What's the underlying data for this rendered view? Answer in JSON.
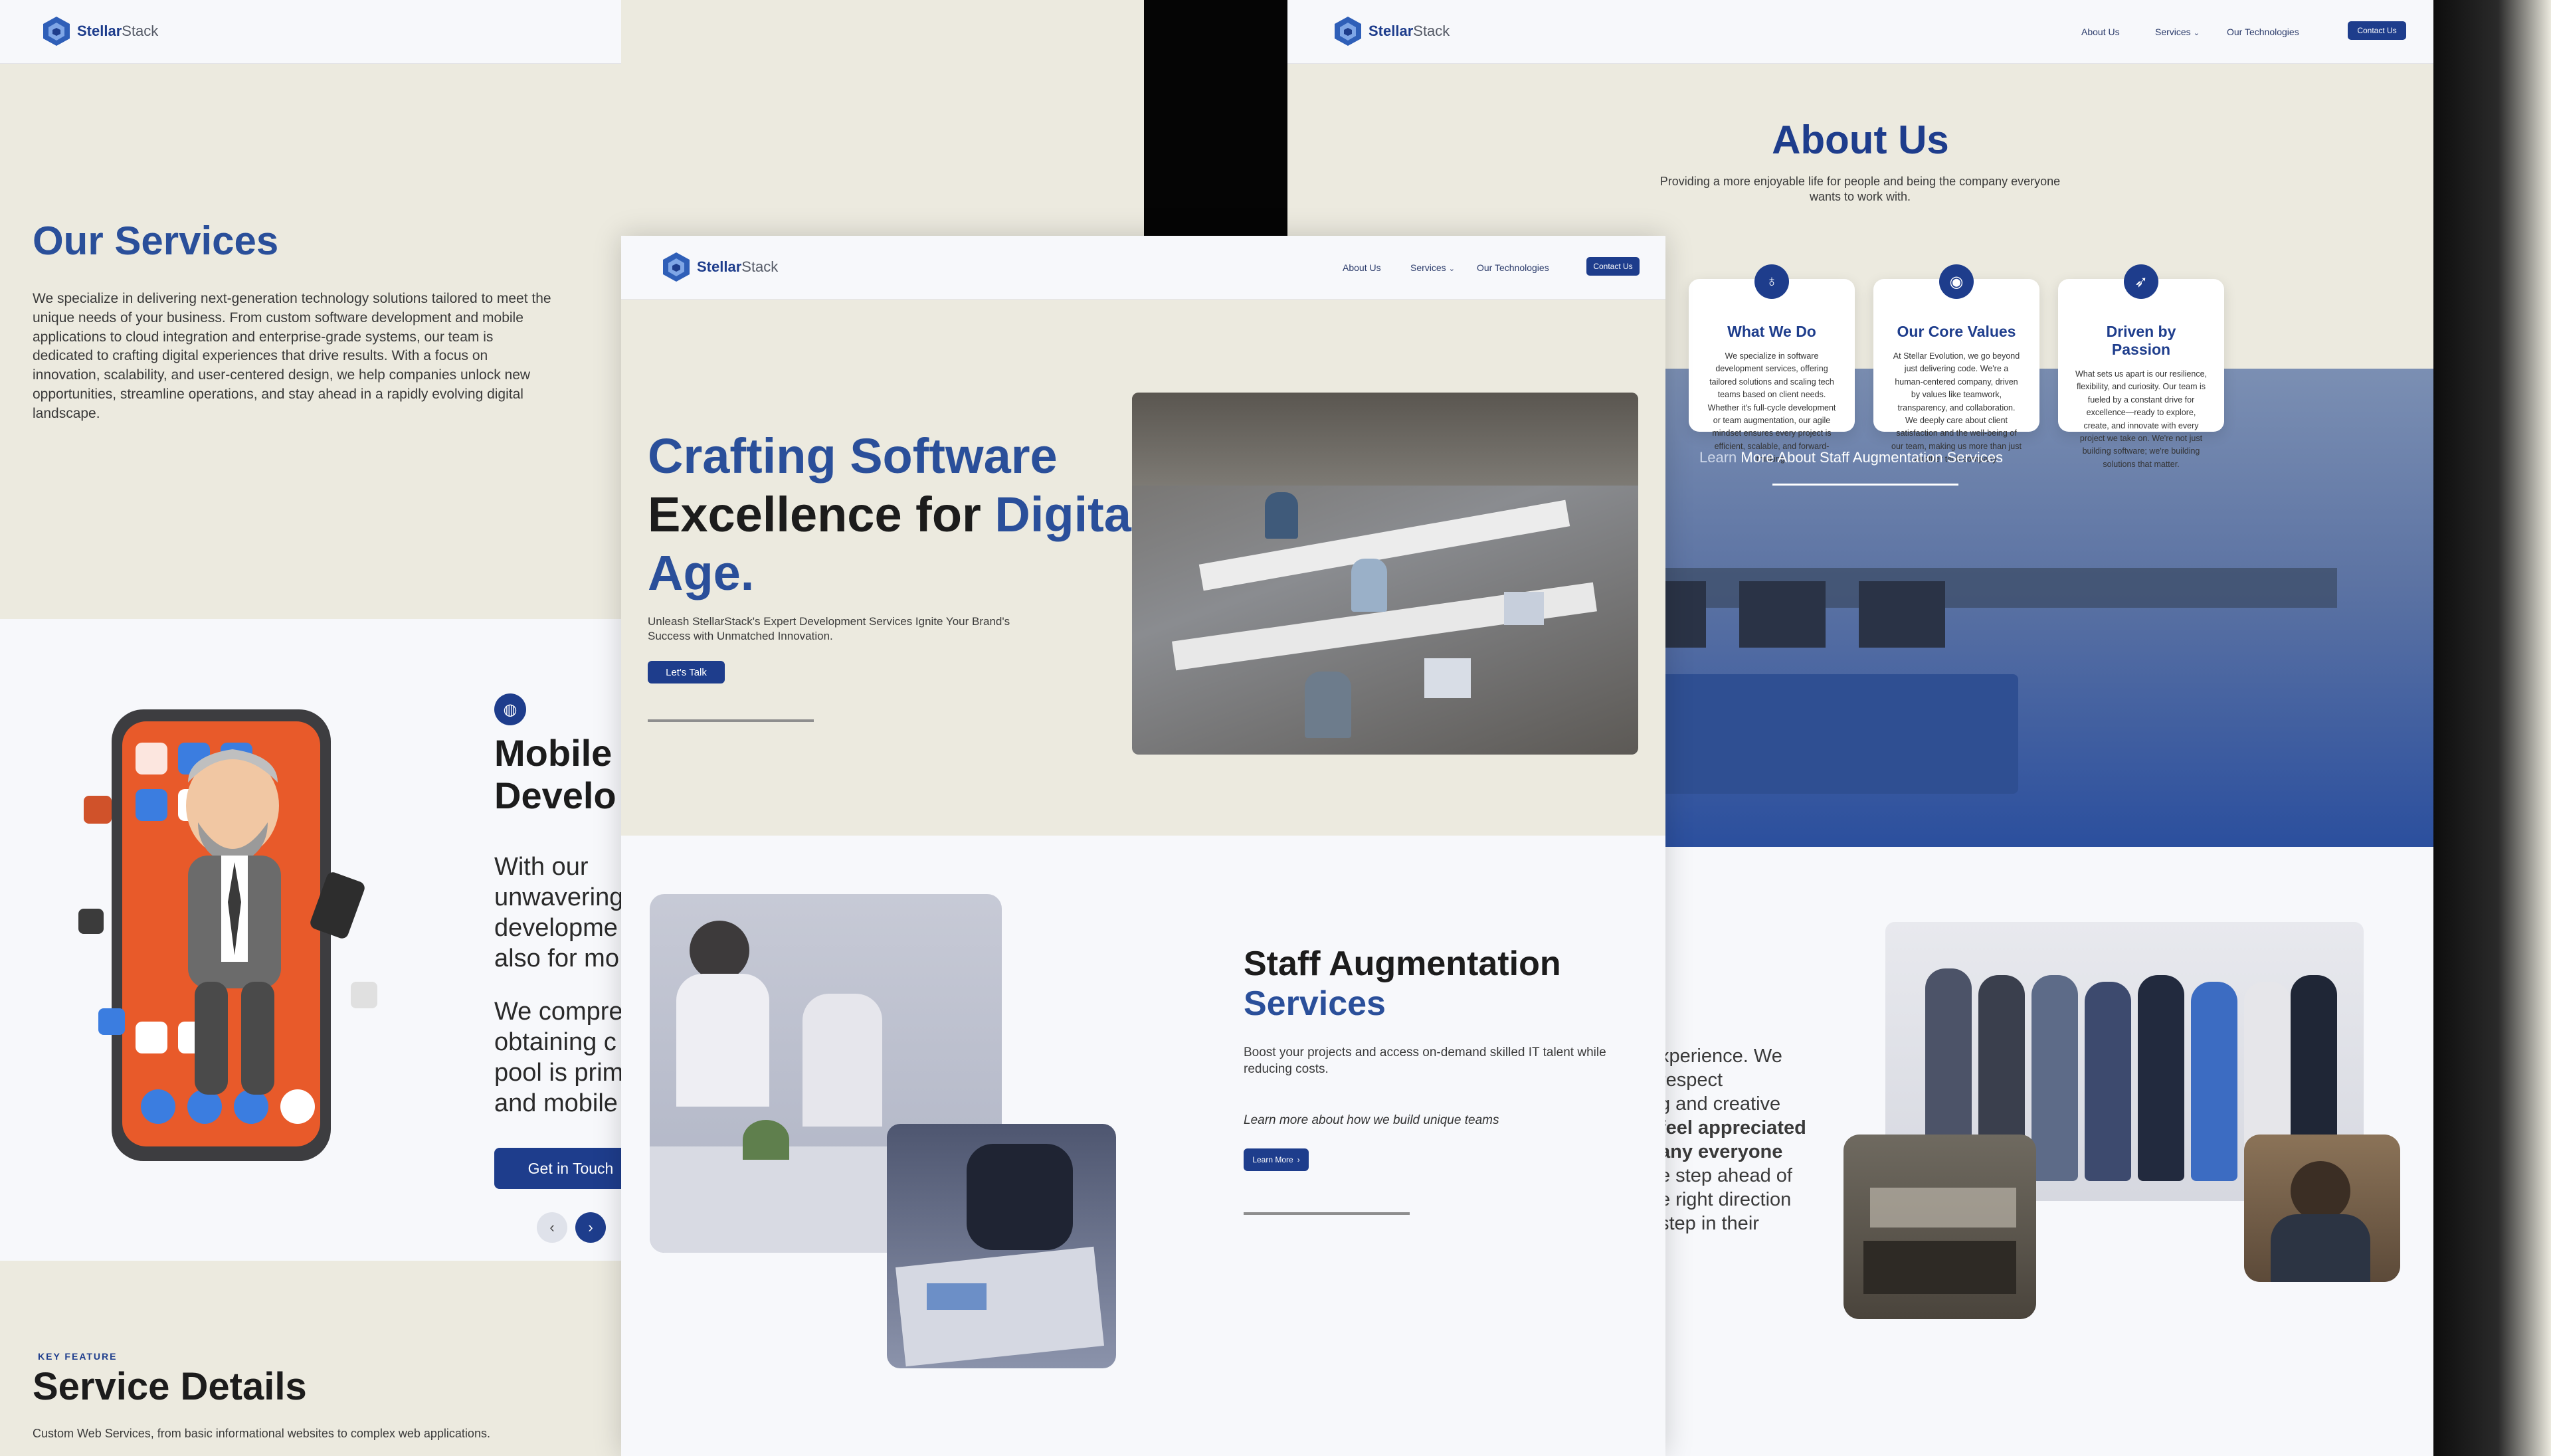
{
  "brand": {
    "name_bold": "Stellar",
    "name_light": "Stack"
  },
  "nav": {
    "about": "About Us",
    "services": "Services",
    "technologies": "Our Technologies",
    "contact": "Contact Us"
  },
  "services_page": {
    "heading": "Our Services",
    "intro": "We specialize in delivering next-generation technology solutions tailored to meet the unique needs of your business. From custom software development and mobile applications to cloud integration and enterprise-grade systems, our team is dedicated to crafting digital experiences that drive results. With a focus on innovation, scalability, and user-centered design, we help companies unlock new opportunities, streamline operations, and stay ahead in a rapidly evolving digital landscape.",
    "mobile_title_1": "Mobile",
    "mobile_title_2": "Develo",
    "mobile_p1": [
      "With our",
      "unwavering",
      "developme",
      "also for mo"
    ],
    "mobile_p2": [
      "We compre",
      "obtaining c",
      "pool is prim",
      "and mobile"
    ],
    "cta": "Get in Touch",
    "key_feature": "KEY FEATURE",
    "details_title": "Service Details",
    "details_text": "Custom Web Services, from basic informational websites to complex web applications."
  },
  "home_page": {
    "hero_1": "Crafting Software",
    "hero_2a": "Excellence for ",
    "hero_2b": "Digital",
    "hero_3": "Age.",
    "subtitle": "Unleash StellarStack's Expert Development Services Ignite Your Brand's Success with Unmatched Innovation.",
    "cta": "Let's Talk",
    "staff_title_1": "Staff Augmentation",
    "staff_title_2": "Services",
    "staff_text": "Boost your projects and access on-demand skilled IT talent while reducing costs.",
    "staff_italic": "Learn more about how we build unique teams",
    "staff_cta": "Learn More"
  },
  "about_page": {
    "heading": "About Us",
    "subtitle": "Providing a more enjoyable life for people and being the company everyone wants to work with.",
    "cards": [
      {
        "title": "What We Do",
        "text": "We specialize in software development services, offering tailored solutions and scaling tech teams based on client needs. Whether it's full-cycle development or team augmentation, our agile mindset ensures every project is efficient, scalable, and forward-thinking."
      },
      {
        "title": "Our Core Values",
        "text": "At Stellar Evolution, we go beyond just delivering code. We're a human-centered company, driven by values like teamwork, transparency, and collaboration. We deeply care about client satisfaction and the well-being of our team, making us more than just another tech company."
      },
      {
        "title": "Driven by Passion",
        "text": "What sets us apart is our resilience, flexibility, and curiosity. Our team is fueled by a constant drive for excellence—ready to explore, create, and innovate with every project we take on. We're not just building software; we're building solutions that matter."
      }
    ],
    "learn_more_a": "Learn ",
    "learn_more_b": "More About Staff Augmentation Services",
    "partial_lines": [
      "xperience. We",
      "respect",
      "g and creative",
      " feel appreciated",
      "any everyone",
      "e step ahead of",
      "e right direction",
      "step in their"
    ]
  }
}
